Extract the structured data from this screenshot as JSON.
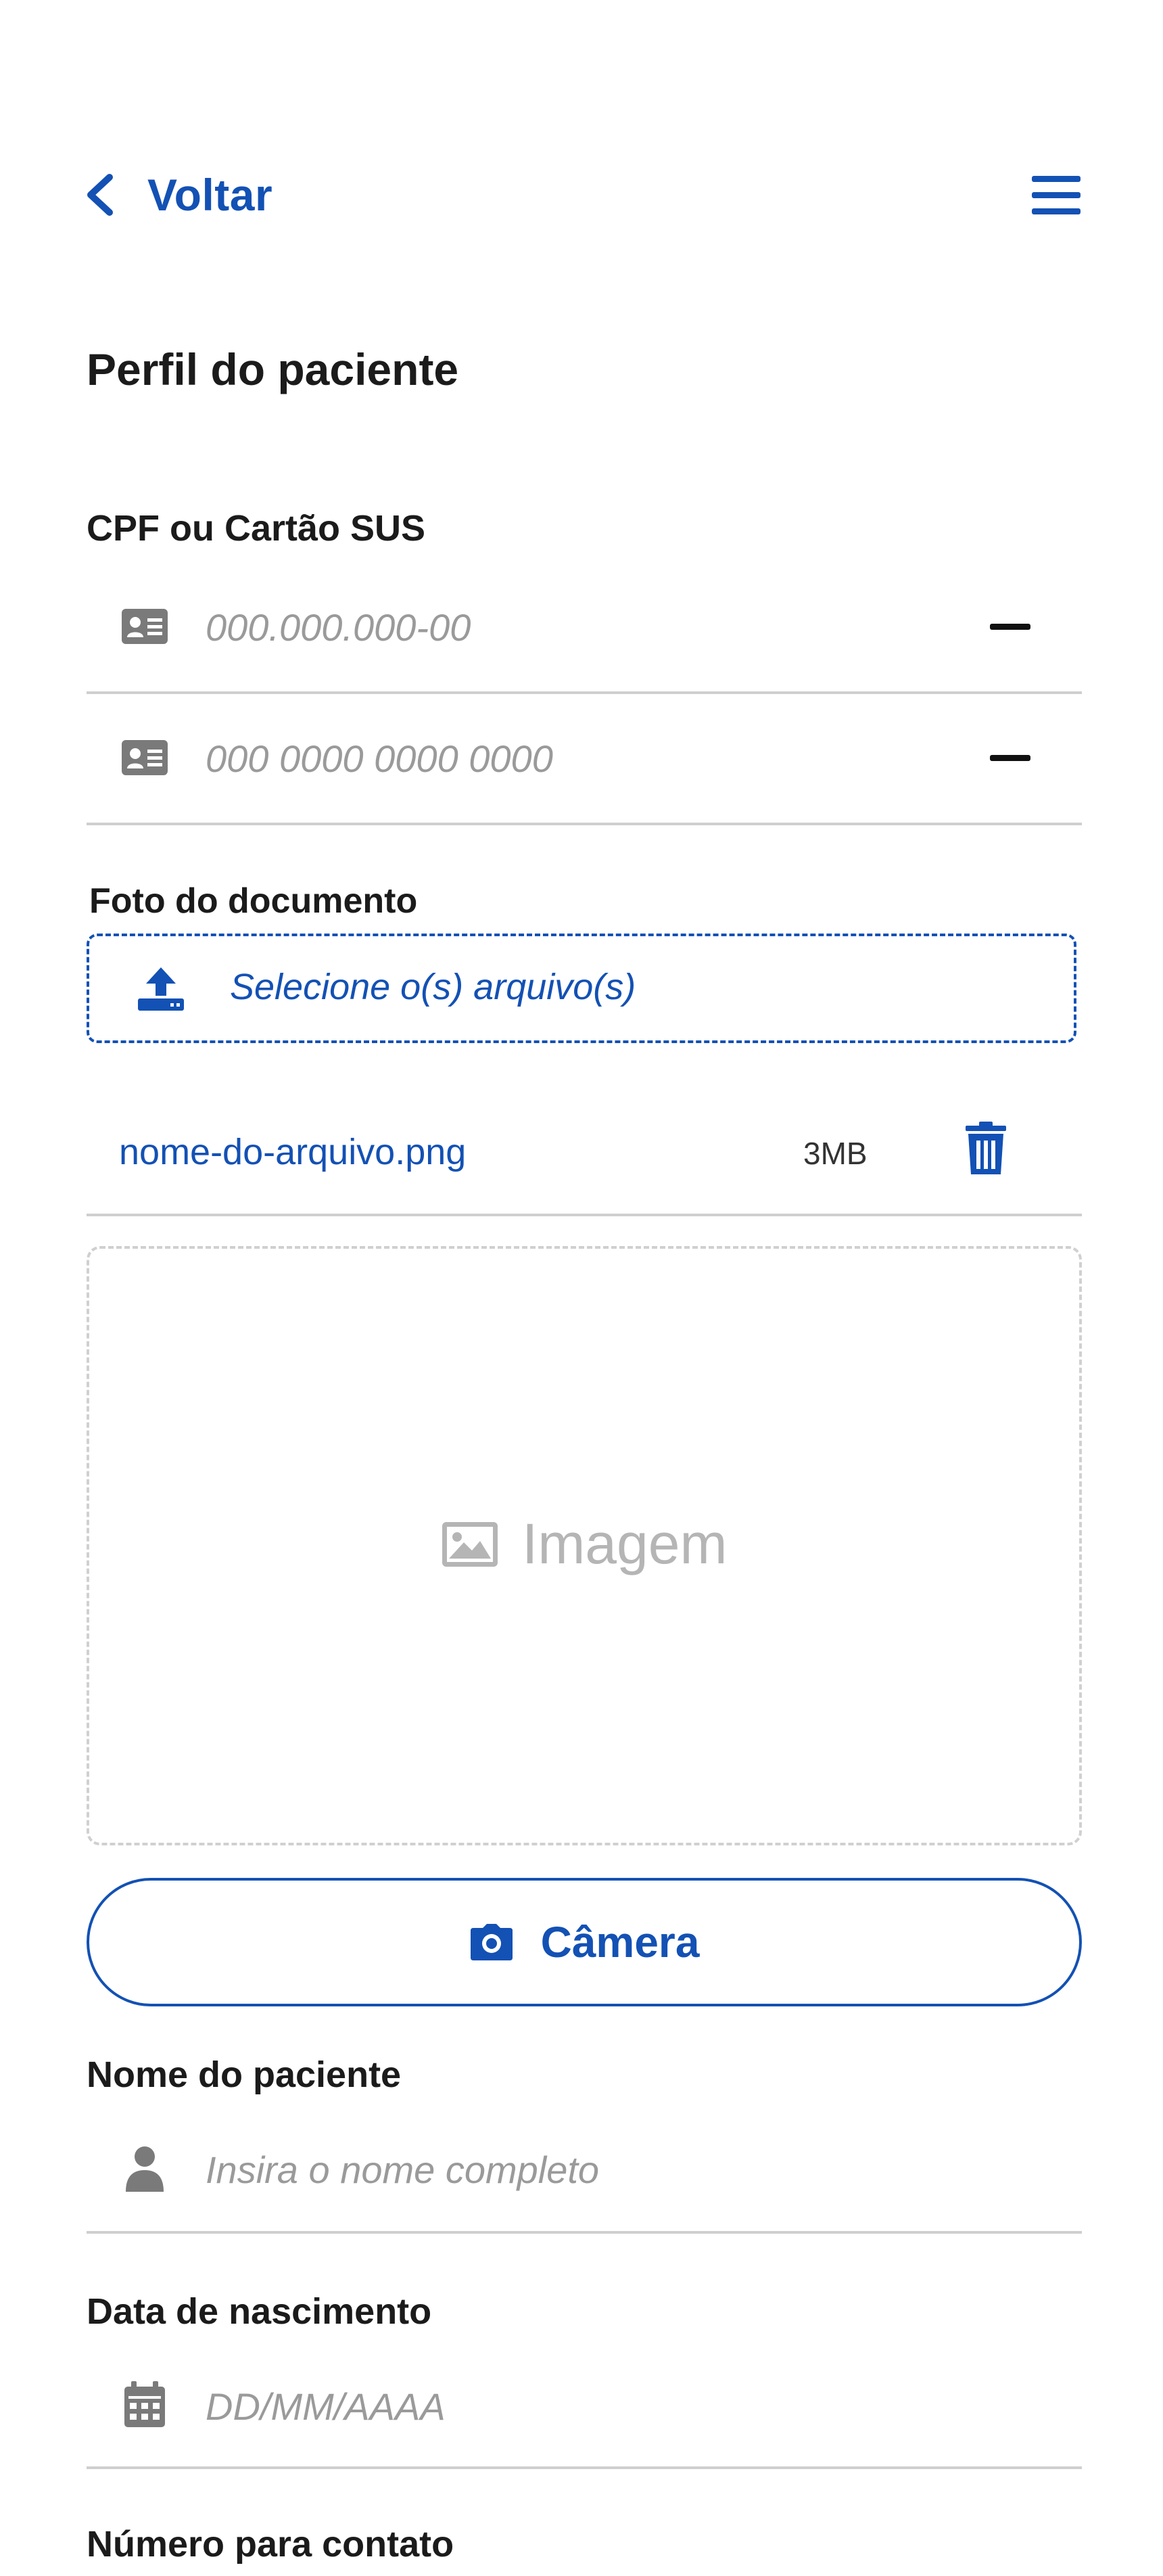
{
  "header": {
    "back_label": "Voltar",
    "menu_icon": "hamburger-menu-icon"
  },
  "page_title": "Perfil do paciente",
  "document_section": {
    "label": "CPF ou Cartão SUS",
    "cpf_placeholder": "000.000.000-00",
    "sus_placeholder": "000 0000 0000 0000"
  },
  "photo_section": {
    "label": "Foto do documento",
    "upload_label": "Selecione o(s) arquivo(s)",
    "file": {
      "name": "nome-do-arquivo.png",
      "size": "3MB"
    },
    "image_label": "Imagem",
    "camera_label": "Câmera"
  },
  "patient_name": {
    "label": "Nome do paciente",
    "placeholder": "Insira o nome completo"
  },
  "birth_date": {
    "label": "Data de nascimento",
    "placeholder": "DD/MM/AAAA"
  },
  "contact": {
    "label": "Número para contato"
  },
  "colors": {
    "primary": "#1351b4",
    "text": "#1b1b1b",
    "placeholder": "#9a9a9a",
    "icon_gray": "#7a7a7a",
    "divider": "#cfcfcf"
  }
}
